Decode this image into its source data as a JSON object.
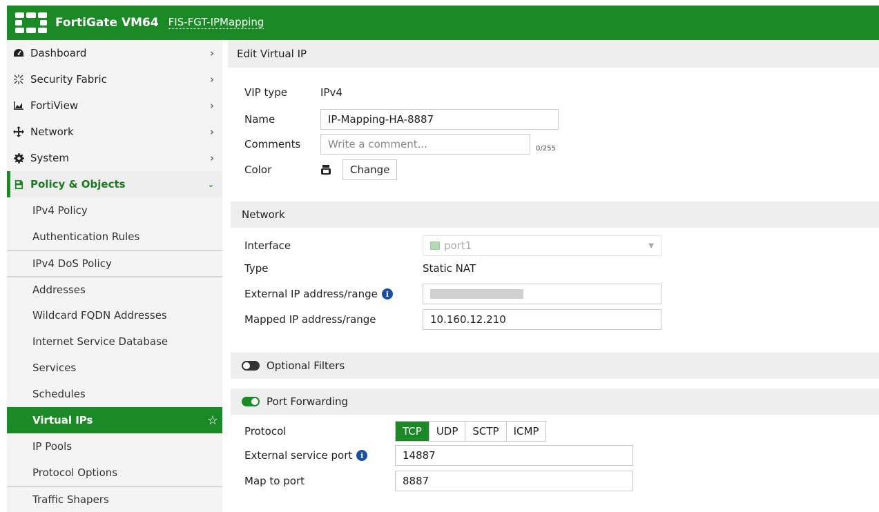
{
  "header": {
    "brand": "FortiGate VM64",
    "hostname": "FIS-FGT-IPMapping",
    "brand_color": "#1b8a26"
  },
  "sidebar": {
    "items": [
      {
        "label": "Dashboard",
        "icon": "dashboard-icon"
      },
      {
        "label": "Security Fabric",
        "icon": "security-fabric-icon"
      },
      {
        "label": "FortiView",
        "icon": "fortiview-icon"
      },
      {
        "label": "Network",
        "icon": "network-icon"
      },
      {
        "label": "System",
        "icon": "gear-icon"
      },
      {
        "label": "Policy & Objects",
        "icon": "policy-icon"
      }
    ],
    "subitems": [
      "IPv4 Policy",
      "Authentication Rules",
      "IPv4 DoS Policy",
      "Addresses",
      "Wildcard FQDN Addresses",
      "Internet Service Database",
      "Services",
      "Schedules",
      "Virtual IPs",
      "IP Pools",
      "Protocol Options",
      "Traffic Shapers"
    ]
  },
  "main": {
    "title": "Edit Virtual IP",
    "vip_type_label": "VIP type",
    "vip_type_value": "IPv4",
    "name_label": "Name",
    "name_value": "IP-Mapping-HA-8887",
    "comments_label": "Comments",
    "comments_placeholder": "Write a comment...",
    "comments_count": "0/255",
    "color_label": "Color",
    "change_button": "Change",
    "network_section": "Network",
    "interface_label": "Interface",
    "interface_value": "port1",
    "type_label": "Type",
    "type_value": "Static NAT",
    "external_ip_label": "External IP address/range",
    "mapped_ip_label": "Mapped IP address/range",
    "mapped_ip_value": "10.160.12.210",
    "optional_filters": "Optional Filters",
    "optional_filters_enabled": false,
    "port_forwarding": "Port Forwarding",
    "port_forwarding_enabled": true,
    "protocol_label": "Protocol",
    "protocols": [
      "TCP",
      "UDP",
      "SCTP",
      "ICMP"
    ],
    "protocol_selected": "TCP",
    "ext_port_label": "External service port",
    "ext_port_value": "14887",
    "map_port_label": "Map to port",
    "map_port_value": "8887"
  }
}
